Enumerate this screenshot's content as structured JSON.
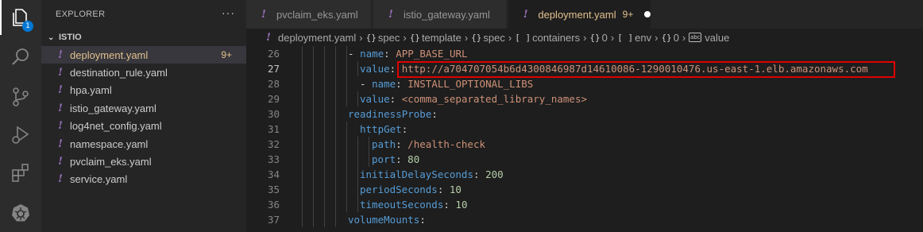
{
  "activity_bar": {
    "explorer_badge": "1",
    "icons": [
      "files-icon",
      "search-icon",
      "source-control-icon",
      "run-debug-icon",
      "extensions-icon",
      "kubernetes-icon"
    ]
  },
  "sidebar": {
    "title": "EXPLORER",
    "more": "···",
    "folder": "ISTIO",
    "files": [
      {
        "name": "deployment.yaml",
        "count": "9+"
      },
      {
        "name": "destination_rule.yaml"
      },
      {
        "name": "hpa.yaml"
      },
      {
        "name": "istio_gateway.yaml"
      },
      {
        "name": "log4net_config.yaml"
      },
      {
        "name": "namespace.yaml"
      },
      {
        "name": "pvclaim_eks.yaml"
      },
      {
        "name": "service.yaml"
      }
    ]
  },
  "tabs": [
    {
      "label": "pvclaim_eks.yaml"
    },
    {
      "label": "istio_gateway.yaml"
    },
    {
      "label": "deployment.yaml",
      "count": "9+"
    }
  ],
  "breadcrumb": {
    "file": "deployment.yaml",
    "items": [
      "spec",
      "template",
      "spec",
      "containers",
      "0",
      "env",
      "0",
      "value"
    ],
    "symbols": [
      "{}",
      "{}",
      "{}",
      "[ ]",
      "{}",
      "[ ]",
      "{}",
      "abc"
    ]
  },
  "editor": {
    "lines": [
      {
        "num": "26",
        "dash": "- ",
        "key": "name",
        "val": "APP_BASE_URL",
        "vtype": "str"
      },
      {
        "num": "27",
        "dash": "",
        "key": "value",
        "val": "http://a704707054b6d4300846987d14610086-1290010476.us-east-1.elb.amazonaws.com",
        "vtype": "str"
      },
      {
        "num": "28",
        "dash": "- ",
        "key": "name",
        "val": "INSTALL_OPTIONAL_LIBS",
        "vtype": "str"
      },
      {
        "num": "29",
        "dash": "",
        "key": "value",
        "val": "<comma_separated_library_names>",
        "vtype": "str"
      },
      {
        "num": "30",
        "dash": "",
        "key": "readinessProbe",
        "val": "",
        "vtype": "none"
      },
      {
        "num": "31",
        "dash": "",
        "key": "httpGet",
        "val": "",
        "vtype": "none"
      },
      {
        "num": "32",
        "dash": "",
        "key": "path",
        "val": "/health-check",
        "vtype": "str"
      },
      {
        "num": "33",
        "dash": "",
        "key": "port",
        "val": "80",
        "vtype": "num"
      },
      {
        "num": "34",
        "dash": "",
        "key": "initialDelaySeconds",
        "val": "200",
        "vtype": "num"
      },
      {
        "num": "35",
        "dash": "",
        "key": "periodSeconds",
        "val": "10",
        "vtype": "num"
      },
      {
        "num": "36",
        "dash": "",
        "key": "timeoutSeconds",
        "val": "10",
        "vtype": "num"
      },
      {
        "num": "37",
        "dash": "",
        "key": "volumeMounts",
        "val": "",
        "vtype": "none"
      }
    ]
  },
  "colors": {
    "key": "#569cd6",
    "string": "#ce9178",
    "number": "#b5cea8",
    "modified": "#e2c08d",
    "highlight_box": "#e00000"
  }
}
